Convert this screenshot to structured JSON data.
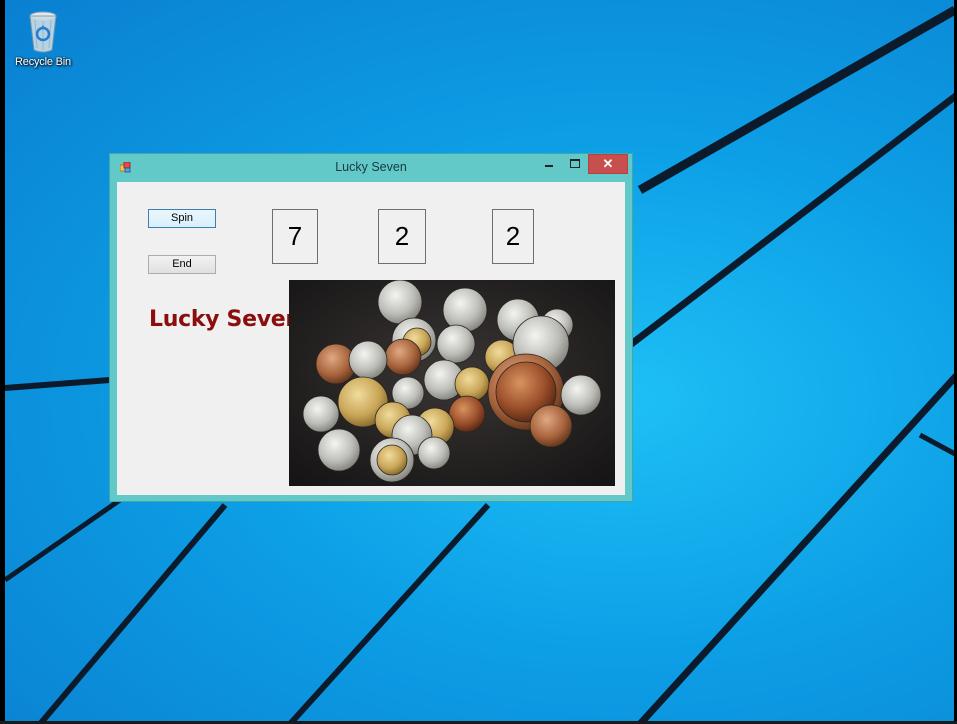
{
  "desktop": {
    "icons": [
      {
        "label": "Recycle Bin",
        "icon": "recycle-bin-icon"
      }
    ]
  },
  "window": {
    "title": "Lucky Seven",
    "app_icon": "app-window-icon",
    "controls": {
      "minimize": "minimize-icon",
      "maximize": "maximize-icon",
      "close": "✕"
    }
  },
  "form": {
    "spin_label": "Spin",
    "end_label": "End",
    "digits": [
      "7",
      "2",
      "2"
    ],
    "lucky_label": "Lucky Seven",
    "label_color": "#8b0d0d",
    "image": "coins-photo"
  },
  "colors": {
    "window_frame": "#62c8c8",
    "close_button": "#c7504f",
    "desktop_blue": "#0d9fe6"
  }
}
